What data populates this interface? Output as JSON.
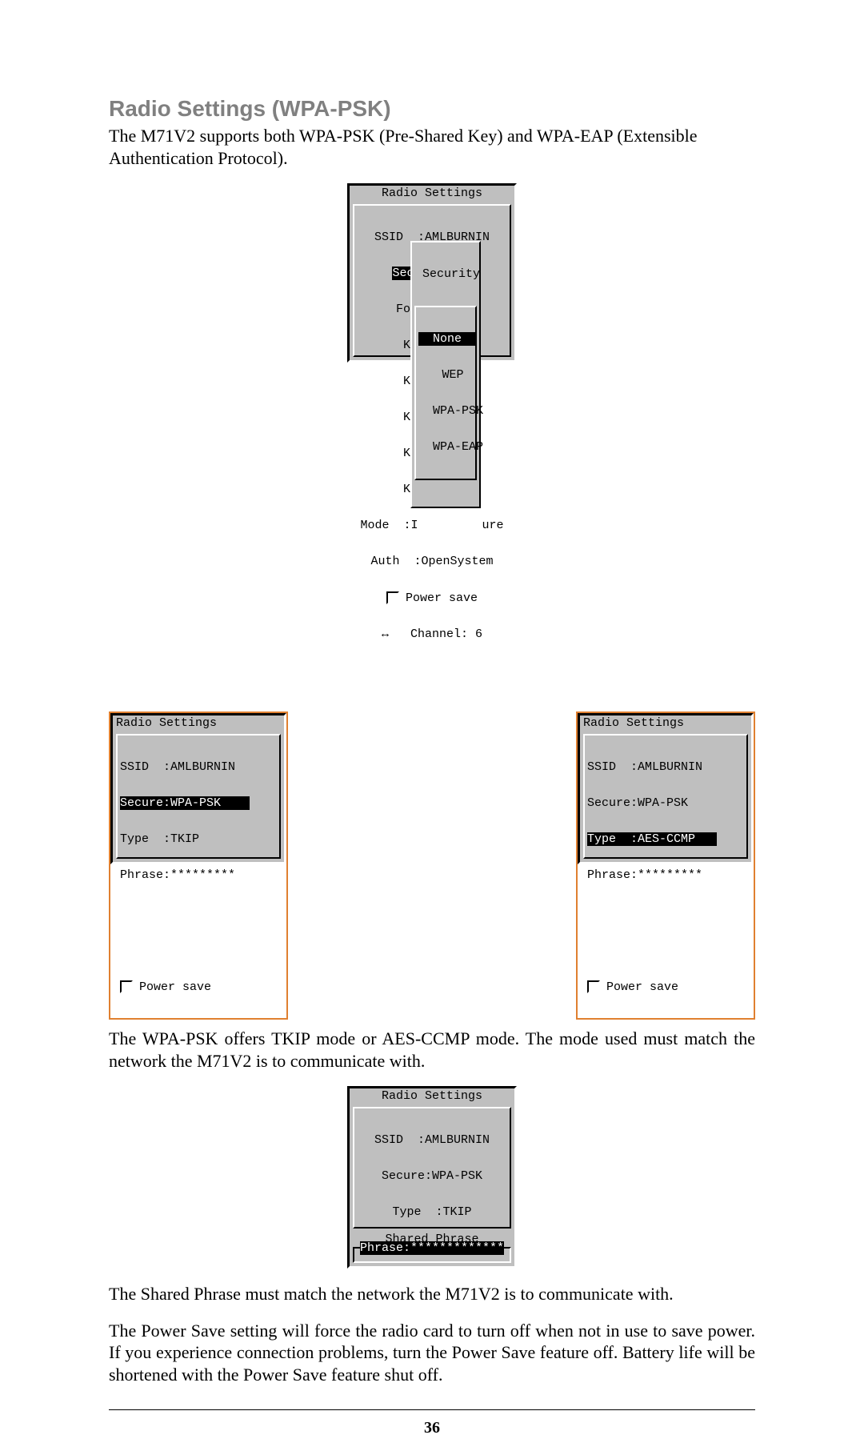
{
  "heading": "Radio Settings (WPA-PSK)",
  "para1": "The M71V2 supports both WPA-PSK (Pre-Shared Key) and WPA-EAP (Extensible Authentication Protocol).",
  "para2": "The WPA-PSK offers TKIP mode or AES-CCMP mode. The mode used must match the network the M71V2 is to communicate with.",
  "para3": "The Shared Phrase must match the network the M71V2 is to communicate with.",
  "para4": "The Power Save setting will force the radio card to turn off when not in use to save power. If you experience connection problems, turn the Power Save feature off. Battery life will be shortened with the Power Save feature shut off.",
  "page_number": "36",
  "screen1": {
    "title": "Radio Settings",
    "ssid": "SSID  :AMLBURNIN",
    "line_secure_inv": "Secure:None",
    "format": "Format:N/A",
    "keyid": "Key ID:N",
    "key0": "Key 0 :N",
    "key1": "Key 1 :N",
    "key2": "Key 2 :N",
    "key3": "Key 3 :N",
    "mode": "Mode  :I",
    "mode_trail": "ure",
    "auth": "Auth  :OpenSystem",
    "power": "Power save",
    "channel": "Channel: 6",
    "popup_title": " Security",
    "popup_none_inv": "  None  ",
    "popup_wep": "  WEP",
    "popup_wpapsk": "  WPA-PSK",
    "popup_wpaeap": "  WPA-EAP"
  },
  "screen2": {
    "title": "Radio Settings",
    "ssid": "SSID  :AMLBURNIN",
    "secure_inv": "Secure:WPA-PSK    ",
    "type": "Type  :TKIP",
    "phrase": "Phrase:*********",
    "power": "Power save"
  },
  "screen3": {
    "title": "Radio Settings",
    "ssid": "SSID  :AMLBURNIN",
    "secure": "Secure:WPA-PSK",
    "type_inv": "Type  :AES-CCMP   ",
    "phrase": "Phrase:*********",
    "power": "Power save"
  },
  "screen4": {
    "title": "Radio Settings",
    "ssid": "SSID  :AMLBURNIN",
    "secure": "Secure:WPA-PSK",
    "type": "Type  :TKIP",
    "phrase_inv": "Phrase:*************",
    "shared": "Shared Phrase"
  }
}
